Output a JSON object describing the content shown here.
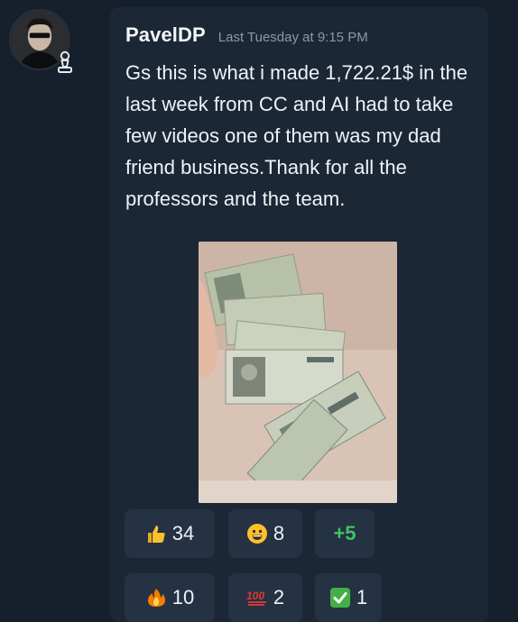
{
  "post": {
    "username": "PavelDP",
    "timestamp": "Last Tuesday at 9:15 PM",
    "message": "Gs this is what i made 1,722.21$ in the last week from CC and AI had to take few videos one of them was my dad friend business.Thank for all the professors and the team.",
    "avatar_icon": "user-avatar",
    "role_icon": "chess-pawn-icon",
    "attachment_icon": "banknotes-photo"
  },
  "reactions": [
    {
      "emoji": "thumbs-up-icon",
      "count": "34"
    },
    {
      "emoji": "grinning-face-icon",
      "count": "8"
    },
    {
      "emoji": "",
      "count": "+5"
    },
    {
      "emoji": "fire-icon",
      "count": "10"
    },
    {
      "emoji": "hundred-points-icon",
      "count": "2"
    },
    {
      "emoji": "check-mark-button-icon",
      "count": "1"
    }
  ],
  "colors": {
    "background": "#15202c",
    "card": "#1c2735",
    "reaction_bg": "#243243",
    "more_reactions": "#43c25c",
    "timestamp": "#8d98a6"
  }
}
